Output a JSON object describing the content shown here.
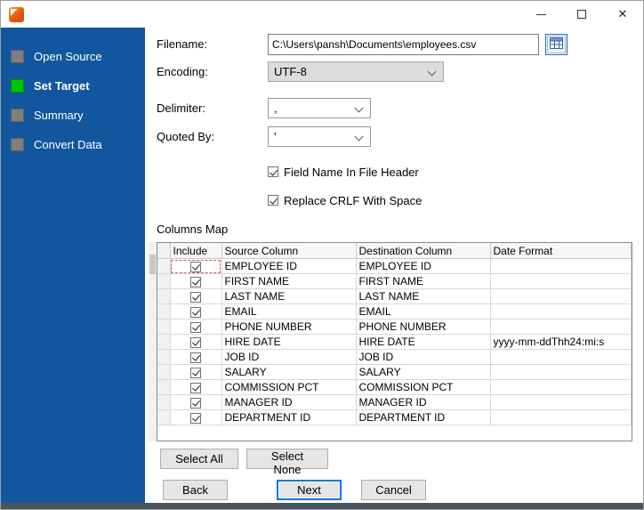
{
  "window": {
    "close_glyph": "✕"
  },
  "sidebar": {
    "steps": [
      {
        "label": "Open Source",
        "active": false
      },
      {
        "label": "Set Target",
        "active": true
      },
      {
        "label": "Summary",
        "active": false
      },
      {
        "label": "Convert Data",
        "active": false
      }
    ]
  },
  "form": {
    "filename": {
      "label": "Filename:",
      "value": "C:\\Users\\pansh\\Documents\\employees.csv"
    },
    "encoding": {
      "label": "Encoding:",
      "value": "UTF-8"
    },
    "delimiter": {
      "label": "Delimiter:",
      "value": ","
    },
    "quoted_by": {
      "label": "Quoted By:",
      "value": "'"
    },
    "field_name_in_header": {
      "label": "Field Name In File Header",
      "checked": true
    },
    "replace_crlf": {
      "label": "Replace CRLF With Space",
      "checked": true
    }
  },
  "columns_map": {
    "title": "Columns Map",
    "headers": [
      "Include",
      "Source Column",
      "Destination Column",
      "Date Format"
    ],
    "rows": [
      {
        "include": true,
        "source": "EMPLOYEE ID",
        "destination": "EMPLOYEE ID",
        "date_format": ""
      },
      {
        "include": true,
        "source": "FIRST NAME",
        "destination": "FIRST NAME",
        "date_format": ""
      },
      {
        "include": true,
        "source": "LAST NAME",
        "destination": "LAST NAME",
        "date_format": ""
      },
      {
        "include": true,
        "source": "EMAIL",
        "destination": "EMAIL",
        "date_format": ""
      },
      {
        "include": true,
        "source": "PHONE NUMBER",
        "destination": "PHONE NUMBER",
        "date_format": ""
      },
      {
        "include": true,
        "source": "HIRE DATE",
        "destination": "HIRE DATE",
        "date_format": "yyyy-mm-ddThh24:mi:s"
      },
      {
        "include": true,
        "source": "JOB ID",
        "destination": "JOB ID",
        "date_format": ""
      },
      {
        "include": true,
        "source": "SALARY",
        "destination": "SALARY",
        "date_format": ""
      },
      {
        "include": true,
        "source": "COMMISSION PCT",
        "destination": "COMMISSION PCT",
        "date_format": ""
      },
      {
        "include": true,
        "source": "MANAGER ID",
        "destination": "MANAGER ID",
        "date_format": ""
      },
      {
        "include": true,
        "source": "DEPARTMENT ID",
        "destination": "DEPARTMENT ID",
        "date_format": ""
      }
    ]
  },
  "buttons": {
    "select_all": "Select All",
    "select_none": "Select None",
    "back": "Back",
    "next": "Next",
    "cancel": "Cancel"
  }
}
